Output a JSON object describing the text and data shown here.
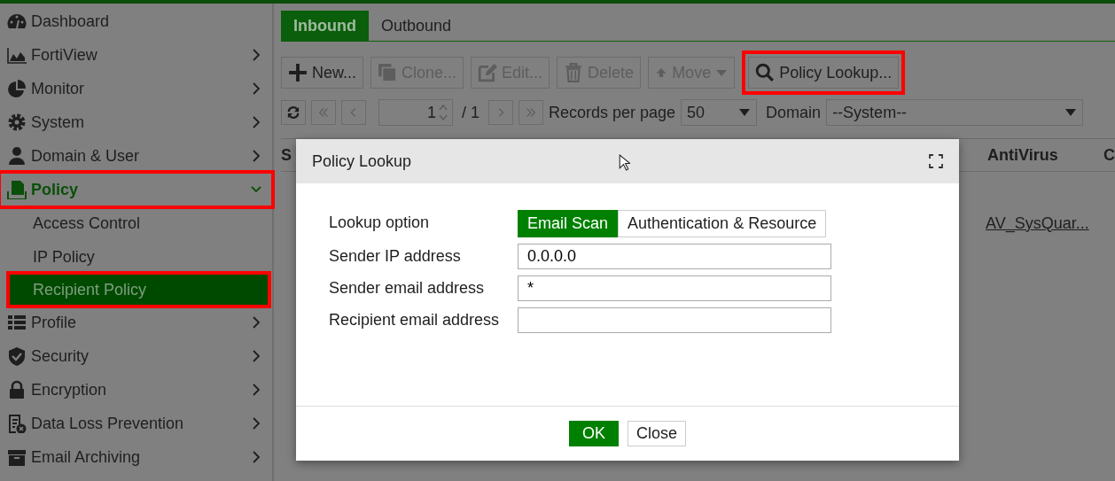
{
  "sidebar": {
    "items": [
      {
        "label": "Dashboard",
        "kind": "link",
        "expanded": false,
        "highlighted": false
      },
      {
        "label": "FortiView",
        "kind": "group",
        "expanded": false,
        "highlighted": false
      },
      {
        "label": "Monitor",
        "kind": "group",
        "expanded": false,
        "highlighted": false
      },
      {
        "label": "System",
        "kind": "group",
        "expanded": false,
        "highlighted": false
      },
      {
        "label": "Domain & User",
        "kind": "group",
        "expanded": false,
        "highlighted": false
      },
      {
        "label": "Policy",
        "kind": "group",
        "expanded": true,
        "highlighted": true,
        "children": [
          {
            "label": "Access Control",
            "selected": false,
            "highlighted": false
          },
          {
            "label": "IP Policy",
            "selected": false,
            "highlighted": false
          },
          {
            "label": "Recipient Policy",
            "selected": true,
            "highlighted": true
          }
        ]
      },
      {
        "label": "Profile",
        "kind": "group",
        "expanded": false,
        "highlighted": false
      },
      {
        "label": "Security",
        "kind": "group",
        "expanded": false,
        "highlighted": false
      },
      {
        "label": "Encryption",
        "kind": "group",
        "expanded": false,
        "highlighted": false
      },
      {
        "label": "Data Loss Prevention",
        "kind": "group",
        "expanded": false,
        "highlighted": false
      },
      {
        "label": "Email Archiving",
        "kind": "group",
        "expanded": false,
        "highlighted": false
      }
    ]
  },
  "tabs": [
    {
      "label": "Inbound",
      "selected": true
    },
    {
      "label": "Outbound",
      "selected": false
    }
  ],
  "toolbar": [
    {
      "label": "New...",
      "disabled": false,
      "highlighted": false
    },
    {
      "label": "Clone...",
      "disabled": true,
      "highlighted": false
    },
    {
      "label": "Edit...",
      "disabled": true,
      "highlighted": false
    },
    {
      "label": "Delete",
      "disabled": true,
      "highlighted": false
    },
    {
      "label": "Move",
      "disabled": true,
      "highlighted": false
    },
    {
      "label": "Policy Lookup...",
      "disabled": false,
      "highlighted": true
    }
  ],
  "pager": {
    "page": "1",
    "total": "/ 1",
    "records_label": "Records per page",
    "records": "50",
    "domain_label": "Domain",
    "domain": "--System--"
  },
  "table": {
    "columns": [
      "S",
      "AntiVirus",
      "C"
    ],
    "rows": [
      {
        "antivirus": "AV_SysQuar..."
      }
    ]
  },
  "dialog": {
    "title": "Policy Lookup",
    "lookup_label": "Lookup option",
    "options": [
      {
        "label": "Email Scan",
        "selected": true
      },
      {
        "label": "Authentication & Resource",
        "selected": false
      }
    ],
    "fields": [
      {
        "label": "Sender IP address",
        "value": "0.0.0.0"
      },
      {
        "label": "Sender email address",
        "value": "*"
      },
      {
        "label": "Recipient email address"
      }
    ],
    "buttons": [
      {
        "label": "OK",
        "kind": "primary"
      },
      {
        "label": "Close",
        "kind": "secondary"
      }
    ]
  }
}
